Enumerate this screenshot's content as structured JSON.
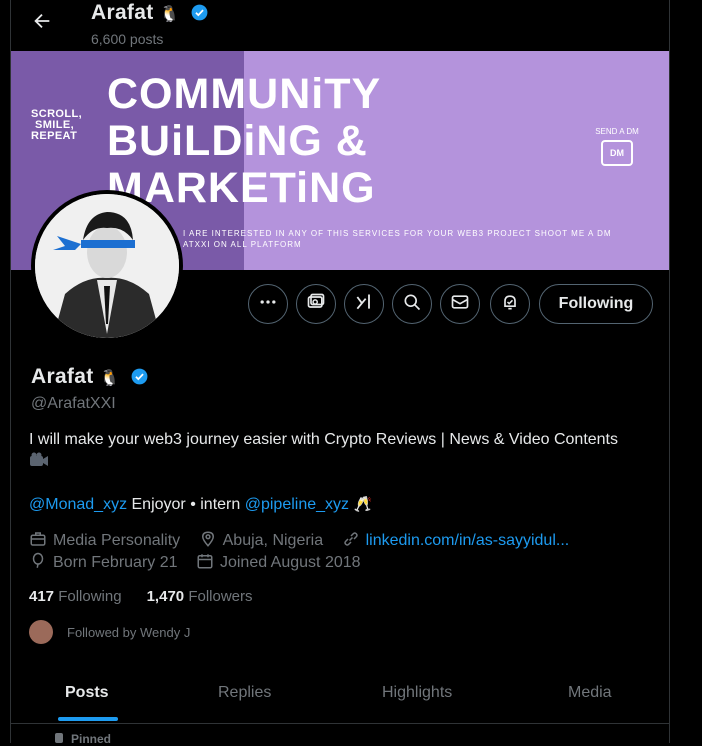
{
  "header": {
    "name": "Arafat",
    "name_emoji": "🐧",
    "posts_count": "6,600 posts"
  },
  "banner": {
    "left_tagline": [
      "SCROLL,",
      "SMILE,",
      "REPEAT"
    ],
    "headline": [
      "COMMUNiTY",
      "BUiLDiNG &",
      "MARKETiNG"
    ],
    "dm_label": "SEND A DM",
    "dm_icon_text": "DM",
    "small_text": [
      "I ARE INTERESTED IN ANY OF THIS SERVICES FOR YOUR WEB3 PROJECT SHOOT ME A DM",
      "ATXXI ON ALL PLATFORM"
    ]
  },
  "actions": {
    "follow_label": "Following"
  },
  "profile": {
    "name": "Arafat",
    "handle": "@ArafatXXI",
    "bio": "I will make your web3 journey easier with Crypto Reviews | News & Video Contents",
    "bio_line2_mention1": "@Monad_xyz",
    "bio_line2_text": " Enjoyor • intern ",
    "bio_line2_mention2": "@pipeline_xyz",
    "category": "Media Personality",
    "location": "Abuja, Nigeria",
    "website": "linkedin.com/in/as-sayyidul...",
    "birthday": "Born February 21",
    "joined": "Joined August 2018",
    "following_count": "417",
    "following_label": "Following",
    "followers_count": "1,470",
    "followers_label": "Followers",
    "followed_by": "Followed by Wendy J"
  },
  "tabs": [
    "Posts",
    "Replies",
    "Highlights",
    "Media"
  ],
  "pinned_label": "Pinned",
  "colors": {
    "accent": "#1d9bf0",
    "banner_light": "#b493dc",
    "banner_dark": "#7a5aa8"
  }
}
